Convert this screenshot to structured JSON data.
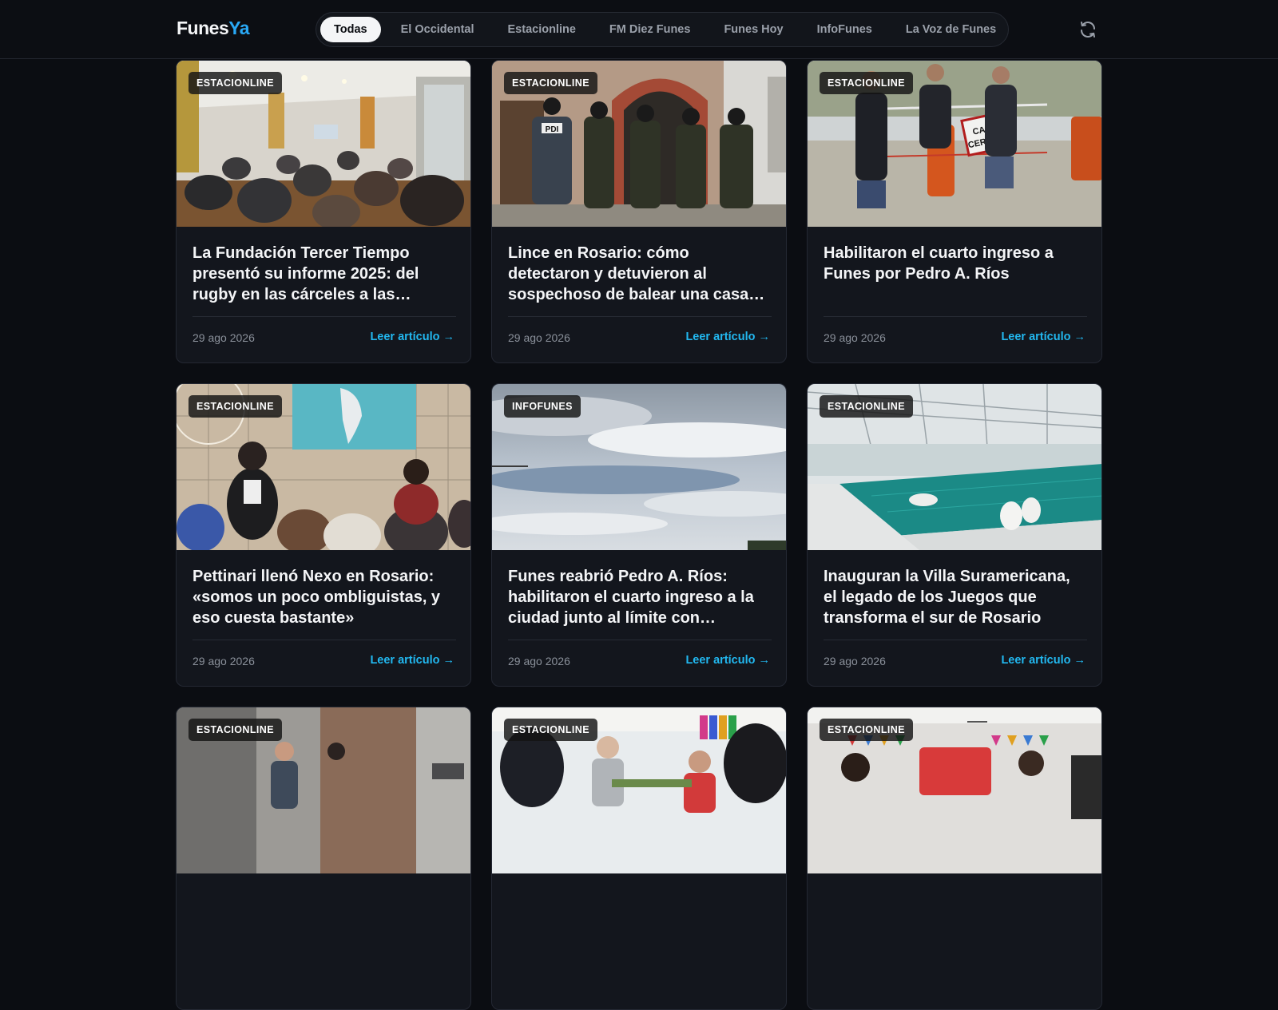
{
  "header": {
    "logo_part1": "Funes",
    "logo_part2": "Ya",
    "tabs": [
      {
        "label": "Todas",
        "active": true
      },
      {
        "label": "El Occidental"
      },
      {
        "label": "Estacionline"
      },
      {
        "label": "FM Diez Funes"
      },
      {
        "label": "Funes Hoy"
      },
      {
        "label": "InfoFunes"
      },
      {
        "label": "La Voz de Funes"
      }
    ],
    "refresh_icon": "refresh-icon"
  },
  "colors": {
    "background": "#0b0d12",
    "card": "#13161d",
    "accent": "#22b8f0",
    "logo_accent": "#29a8f5"
  },
  "articles": [
    {
      "source": "ESTACIONLINE",
      "title": "La Fundación Tercer Tiempo presentó su informe 2025: del rugby en las cárceles a las…",
      "date": "29 ago 2026",
      "link": "Leer artículo →"
    },
    {
      "source": "ESTACIONLINE",
      "title": "Lince en Rosario: cómo detectaron y detuvieron al sospechoso de balear una casa…",
      "date": "29 ago 2026",
      "link": "Leer artículo →"
    },
    {
      "source": "ESTACIONLINE",
      "title": "Habilitaron el cuarto ingreso a Funes por Pedro A. Ríos",
      "date": "29 ago 2026",
      "link": "Leer artículo →"
    },
    {
      "source": "ESTACIONLINE",
      "title": "Pettinari llenó Nexo en Rosario: «somos un poco ombliguistas, y eso cuesta bastante»",
      "date": "29 ago 2026",
      "link": "Leer artículo →"
    },
    {
      "source": "INFOFUNES",
      "title": "Funes reabrió Pedro A. Ríos: habilitaron el cuarto ingreso a la ciudad junto al límite con…",
      "date": "29 ago 2026",
      "link": "Leer artículo →"
    },
    {
      "source": "ESTACIONLINE",
      "title": "Inauguran la Villa Suramericana, el legado de los Juegos que transforma el sur de Rosario",
      "date": "29 ago 2026",
      "link": "Leer artículo →"
    },
    {
      "source": "ESTACIONLINE",
      "title": "",
      "date": "",
      "link": ""
    },
    {
      "source": "ESTACIONLINE",
      "title": "",
      "date": "",
      "link": ""
    },
    {
      "source": "ESTACIONLINE",
      "title": "",
      "date": "",
      "link": ""
    }
  ],
  "sign_text": "CALLE CERRADA",
  "vest_text": "PDI"
}
